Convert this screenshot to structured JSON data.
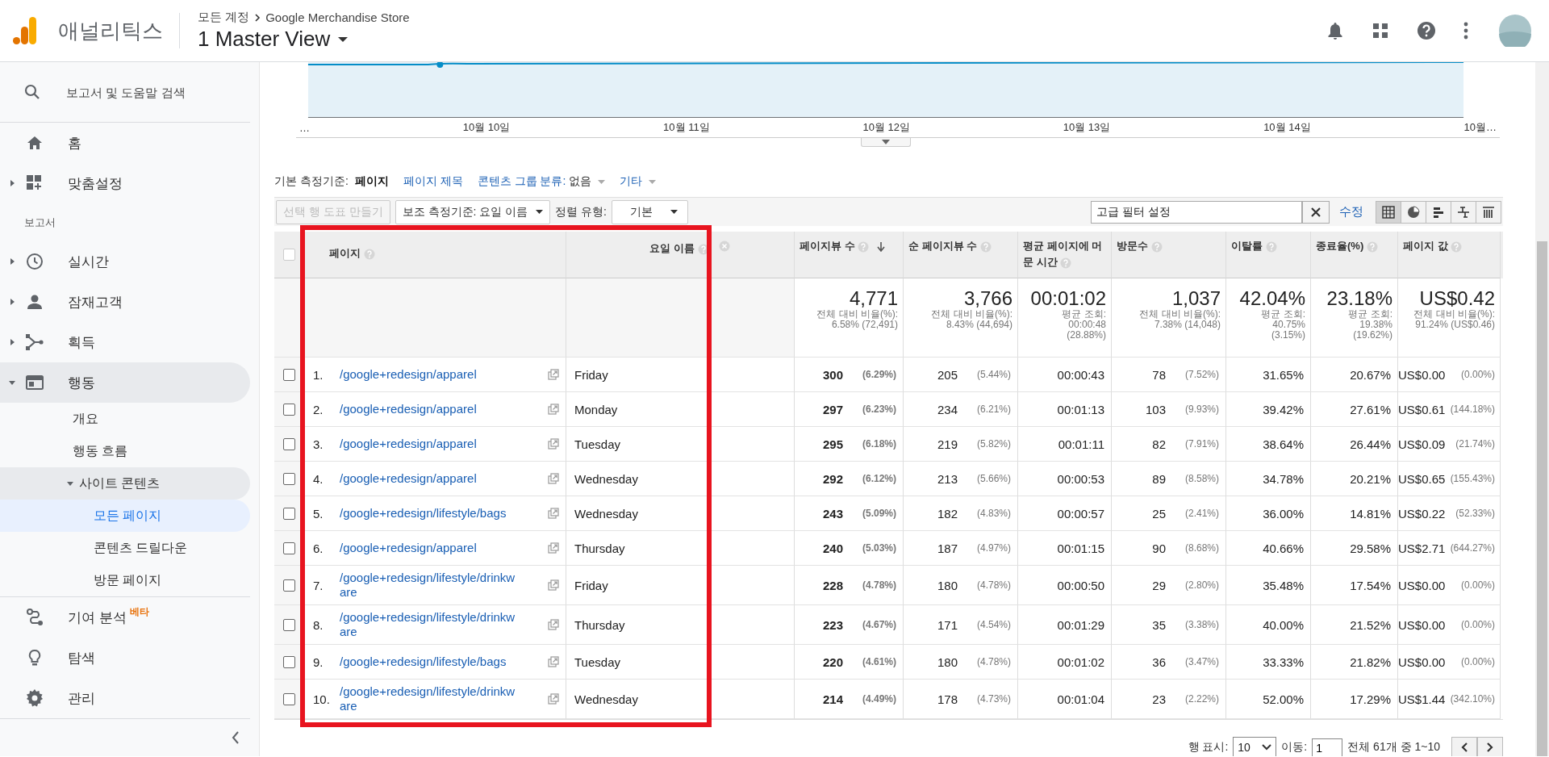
{
  "header": {
    "app_name": "애널리틱스",
    "breadcrumb": [
      "모든 계정",
      "Google Merchandise Store"
    ],
    "view_name": "1 Master View"
  },
  "sidebar": {
    "search": {
      "placeholder": "보고서 및 도움말 검색"
    },
    "items": [
      {
        "kind": "item",
        "label": "홈",
        "selected": false
      },
      {
        "kind": "item",
        "label": "맞춤설정",
        "selected": false,
        "expanded": false
      },
      {
        "kind": "section",
        "label": "보고서"
      },
      {
        "kind": "item",
        "label": "실시간",
        "selected": false,
        "expanded": false
      },
      {
        "kind": "item",
        "label": "잠재고객",
        "selected": false,
        "expanded": false
      },
      {
        "kind": "item",
        "label": "획득",
        "selected": false,
        "expanded": false
      },
      {
        "kind": "item",
        "label": "행동",
        "selected": false,
        "expanded": true,
        "children": [
          {
            "label": "개요",
            "selected": false
          },
          {
            "label": "행동 흐름",
            "selected": false
          },
          {
            "label": "사이트 콘텐츠",
            "selected": false,
            "expanded": true,
            "children": [
              {
                "label": "모든 페이지",
                "selected": true
              },
              {
                "label": "콘텐츠 드릴다운",
                "selected": false
              },
              {
                "label": "방문 페이지",
                "selected": false
              }
            ]
          }
        ]
      }
    ],
    "bottom_items": [
      {
        "label": "기여 분석",
        "badge": "베타",
        "selected": false
      },
      {
        "label": "탐색",
        "selected": false
      },
      {
        "label": "관리",
        "selected": false
      }
    ]
  },
  "chart": {
    "x_labels": [
      "…",
      "10월 10일",
      "10월 11일",
      "10월 12일",
      "10월 13일",
      "10월 14일",
      "10월…"
    ]
  },
  "dimensions": {
    "label": "기본 측정기준:",
    "options": [
      {
        "label": "페이지",
        "selected": true
      },
      {
        "label": "페이지 제목",
        "selected": false
      },
      {
        "label": "콘텐츠 그룹 분류:",
        "value": "없음",
        "selected": false,
        "dropdown": true
      },
      {
        "label": "기타",
        "selected": false,
        "dropdown": true
      }
    ]
  },
  "toolbar": {
    "chart_button": {
      "label": "선택 행 도표 만들기",
      "disabled": true
    },
    "secondary": {
      "label": "보조 측정기준: 요일 이름"
    },
    "sort_label": "정렬 유형:",
    "sort": {
      "value": "기본"
    },
    "filter": {
      "value": "고급 필터 설정"
    },
    "edit_link": "수정",
    "views": [
      {
        "selected": true
      },
      {
        "selected": false
      },
      {
        "selected": false
      },
      {
        "selected": false
      },
      {
        "selected": false
      }
    ]
  },
  "table": {
    "select_all": {
      "checked": false
    },
    "columns": [
      {
        "label": "페이지",
        "kind": "dimension"
      },
      {
        "label": "요일 이름",
        "kind": "dimension",
        "removable": true
      },
      {
        "label": "페이지뷰 수",
        "kind": "metric",
        "sorted": true
      },
      {
        "label": "순 페이지뷰 수",
        "kind": "metric",
        "sorted": false
      },
      {
        "label": "평균 페이지에 머문 시간",
        "kind": "metric",
        "sorted": false
      },
      {
        "label": "방문수",
        "kind": "metric",
        "sorted": false
      },
      {
        "label": "이탈률",
        "kind": "metric",
        "sorted": false
      },
      {
        "label": "종료율(%)",
        "kind": "metric",
        "sorted": false
      },
      {
        "label": "페이지 값",
        "kind": "metric",
        "sorted": false
      }
    ],
    "summary": [
      {
        "value": "4,771",
        "sub": [
          "전체 대비 비율(%):",
          "6.58% (72,491)"
        ]
      },
      {
        "value": "3,766",
        "sub": [
          "전체 대비 비율(%):",
          "8.43% (44,694)"
        ]
      },
      {
        "value": "00:01:02",
        "sub": [
          "평균 조회:",
          "00:00:48",
          "(28.88%)"
        ]
      },
      {
        "value": "1,037",
        "sub": [
          "전체 대비 비율(%):",
          "7.38% (14,048)"
        ]
      },
      {
        "value": "42.04%",
        "sub": [
          "평균 조회:",
          "40.75%",
          "(3.15%)"
        ]
      },
      {
        "value": "23.18%",
        "sub": [
          "평균 조회:",
          "19.38%",
          "(19.62%)"
        ]
      },
      {
        "value": "US$0.42",
        "sub": [
          "전체 대비 비율(%):",
          "91.24% (US$0.46)"
        ]
      }
    ],
    "rows": [
      {
        "checked": false,
        "rank": "1.",
        "page": "/google+redesign/apparel",
        "day": "Friday",
        "metrics": [
          {
            "value": "300",
            "share": "(6.29%)"
          },
          {
            "value": "205",
            "share": "(5.44%)"
          },
          {
            "value": "00:00:43"
          },
          {
            "value": "78",
            "share": "(7.52%)"
          },
          {
            "value": "31.65%"
          },
          {
            "value": "20.67%"
          },
          {
            "value": "US$0.00",
            "share": "(0.00%)"
          }
        ]
      },
      {
        "checked": false,
        "rank": "2.",
        "page": "/google+redesign/apparel",
        "day": "Monday",
        "metrics": [
          {
            "value": "297",
            "share": "(6.23%)"
          },
          {
            "value": "234",
            "share": "(6.21%)"
          },
          {
            "value": "00:01:13"
          },
          {
            "value": "103",
            "share": "(9.93%)"
          },
          {
            "value": "39.42%"
          },
          {
            "value": "27.61%"
          },
          {
            "value": "US$0.61",
            "share": "(144.18%)"
          }
        ]
      },
      {
        "checked": false,
        "rank": "3.",
        "page": "/google+redesign/apparel",
        "day": "Tuesday",
        "metrics": [
          {
            "value": "295",
            "share": "(6.18%)"
          },
          {
            "value": "219",
            "share": "(5.82%)"
          },
          {
            "value": "00:01:11"
          },
          {
            "value": "82",
            "share": "(7.91%)"
          },
          {
            "value": "38.64%"
          },
          {
            "value": "26.44%"
          },
          {
            "value": "US$0.09",
            "share": "(21.74%)"
          }
        ]
      },
      {
        "checked": false,
        "rank": "4.",
        "page": "/google+redesign/apparel",
        "day": "Wednesday",
        "metrics": [
          {
            "value": "292",
            "share": "(6.12%)"
          },
          {
            "value": "213",
            "share": "(5.66%)"
          },
          {
            "value": "00:00:53"
          },
          {
            "value": "89",
            "share": "(8.58%)"
          },
          {
            "value": "34.78%"
          },
          {
            "value": "20.21%"
          },
          {
            "value": "US$0.65",
            "share": "(155.43%)"
          }
        ]
      },
      {
        "checked": false,
        "rank": "5.",
        "page": "/google+redesign/lifestyle/bags",
        "day": "Wednesday",
        "metrics": [
          {
            "value": "243",
            "share": "(5.09%)"
          },
          {
            "value": "182",
            "share": "(4.83%)"
          },
          {
            "value": "00:00:57"
          },
          {
            "value": "25",
            "share": "(2.41%)"
          },
          {
            "value": "36.00%"
          },
          {
            "value": "14.81%"
          },
          {
            "value": "US$0.22",
            "share": "(52.33%)"
          }
        ]
      },
      {
        "checked": false,
        "rank": "6.",
        "page": "/google+redesign/apparel",
        "day": "Thursday",
        "metrics": [
          {
            "value": "240",
            "share": "(5.03%)"
          },
          {
            "value": "187",
            "share": "(4.97%)"
          },
          {
            "value": "00:01:15"
          },
          {
            "value": "90",
            "share": "(8.68%)"
          },
          {
            "value": "40.66%"
          },
          {
            "value": "29.58%"
          },
          {
            "value": "US$2.71",
            "share": "(644.27%)"
          }
        ]
      },
      {
        "checked": false,
        "rank": "7.",
        "page": "/google+redesign/lifestyle/drinkware",
        "day": "Friday",
        "metrics": [
          {
            "value": "228",
            "share": "(4.78%)"
          },
          {
            "value": "180",
            "share": "(4.78%)"
          },
          {
            "value": "00:00:50"
          },
          {
            "value": "29",
            "share": "(2.80%)"
          },
          {
            "value": "35.48%"
          },
          {
            "value": "17.54%"
          },
          {
            "value": "US$0.00",
            "share": "(0.00%)"
          }
        ]
      },
      {
        "checked": false,
        "rank": "8.",
        "page": "/google+redesign/lifestyle/drinkware",
        "day": "Thursday",
        "metrics": [
          {
            "value": "223",
            "share": "(4.67%)"
          },
          {
            "value": "171",
            "share": "(4.54%)"
          },
          {
            "value": "00:01:29"
          },
          {
            "value": "35",
            "share": "(3.38%)"
          },
          {
            "value": "40.00%"
          },
          {
            "value": "21.52%"
          },
          {
            "value": "US$0.00",
            "share": "(0.00%)"
          }
        ]
      },
      {
        "checked": false,
        "rank": "9.",
        "page": "/google+redesign/lifestyle/bags",
        "day": "Tuesday",
        "metrics": [
          {
            "value": "220",
            "share": "(4.61%)"
          },
          {
            "value": "180",
            "share": "(4.78%)"
          },
          {
            "value": "00:01:02"
          },
          {
            "value": "36",
            "share": "(3.47%)"
          },
          {
            "value": "33.33%"
          },
          {
            "value": "21.82%"
          },
          {
            "value": "US$0.00",
            "share": "(0.00%)"
          }
        ]
      },
      {
        "checked": false,
        "rank": "10.",
        "page": "/google+redesign/lifestyle/drinkware",
        "day": "Wednesday",
        "metrics": [
          {
            "value": "214",
            "share": "(4.49%)"
          },
          {
            "value": "178",
            "share": "(4.73%)"
          },
          {
            "value": "00:01:04"
          },
          {
            "value": "23",
            "share": "(2.22%)"
          },
          {
            "value": "52.00%"
          },
          {
            "value": "17.29%"
          },
          {
            "value": "US$1.44",
            "share": "(342.10%)"
          }
        ]
      }
    ]
  },
  "pagination": {
    "rows_label": "행 표시:",
    "rows_value": "10",
    "goto_label": "이동:",
    "goto_value": "1",
    "range": "전체 61개 중 1~10"
  }
}
